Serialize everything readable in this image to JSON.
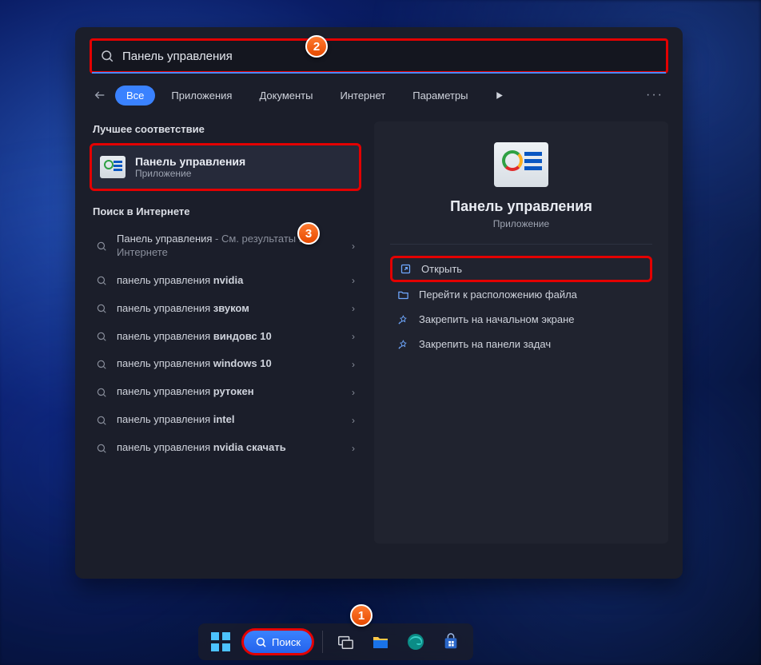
{
  "search": {
    "value": "Панель управления",
    "placeholder": "Поиск"
  },
  "filters": {
    "back_aria": "Назад",
    "tabs": [
      "Все",
      "Приложения",
      "Документы",
      "Интернет",
      "Параметры"
    ],
    "active_index": 0,
    "more": "···"
  },
  "left": {
    "best_label": "Лучшее соответствие",
    "best_match": {
      "title": "Панель управления",
      "subtitle": "Приложение"
    },
    "web_label": "Поиск в Интернете",
    "web_items": [
      {
        "prefix": "Панель управления",
        "suffix": " - См. результаты в Интернете"
      },
      {
        "prefix": "панель управления ",
        "bold": "nvidia"
      },
      {
        "prefix": "панель управления ",
        "bold": "звуком"
      },
      {
        "prefix": "панель управления ",
        "bold": "виндовс 10"
      },
      {
        "prefix": "панель управления ",
        "bold": "windows 10"
      },
      {
        "prefix": "панель управления ",
        "bold": "рутокен"
      },
      {
        "prefix": "панель управления ",
        "bold": "intel"
      },
      {
        "prefix": "панель управления ",
        "bold": "nvidia скачать"
      }
    ]
  },
  "right": {
    "title": "Панель управления",
    "subtitle": "Приложение",
    "actions": [
      {
        "icon": "open",
        "label": "Открыть"
      },
      {
        "icon": "folder",
        "label": "Перейти к расположению файла"
      },
      {
        "icon": "pin",
        "label": "Закрепить на начальном экране"
      },
      {
        "icon": "pin",
        "label": "Закрепить на панели задач"
      }
    ]
  },
  "taskbar": {
    "search_label": "Поиск"
  },
  "badges": {
    "b1": "1",
    "b2": "2",
    "b3": "3"
  }
}
